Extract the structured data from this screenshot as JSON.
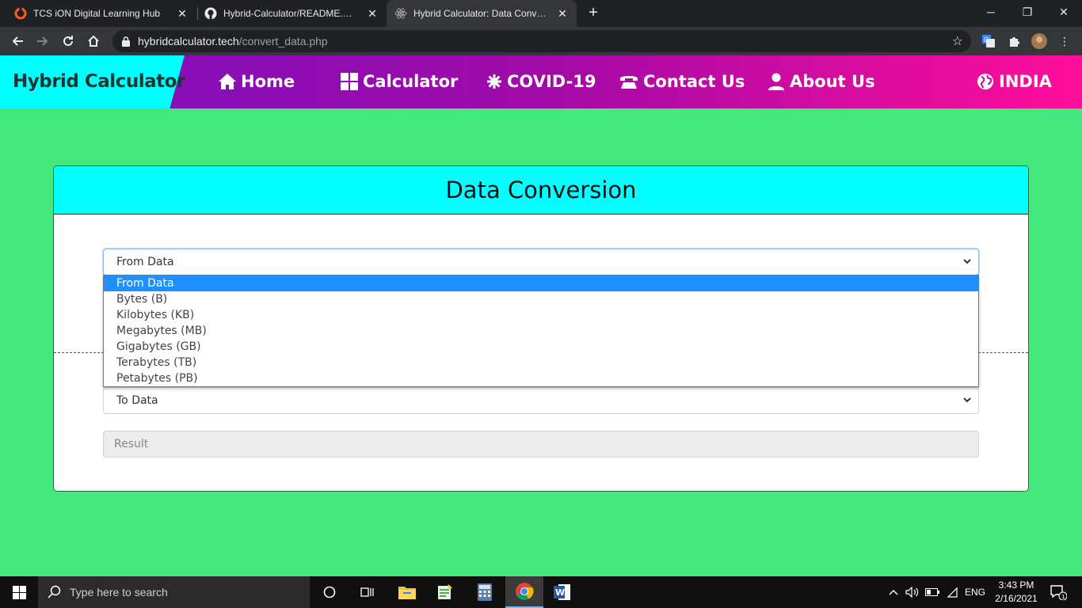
{
  "browser": {
    "tabs": [
      {
        "title": "TCS iON Digital Learning Hub",
        "icon": "tcs-ion-icon"
      },
      {
        "title": "Hybrid-Calculator/README.md at",
        "icon": "github-icon"
      },
      {
        "title": "Hybrid Calculator: Data Conversion",
        "icon": "atom-icon"
      }
    ],
    "url_domain": "hybridcalculator.tech",
    "url_path": "/convert_data.php"
  },
  "site": {
    "brand": "Hybrid Calculator",
    "nav": [
      {
        "label": "Home",
        "icon": "home-icon"
      },
      {
        "label": "Calculator",
        "icon": "grid-icon"
      },
      {
        "label": "COVID-19",
        "icon": "virus-icon"
      },
      {
        "label": "Contact Us",
        "icon": "phone-icon"
      },
      {
        "label": "About Us",
        "icon": "user-icon"
      }
    ],
    "region": {
      "label": "INDIA",
      "icon": "globe-icon"
    }
  },
  "card": {
    "title": "Data Conversion",
    "from_select": {
      "selected": "From Data"
    },
    "to_select": {
      "selected": "To Data"
    },
    "result_placeholder": "Result",
    "options": [
      "From Data",
      "Bytes (B)",
      "Kilobytes (KB)",
      "Megabytes (MB)",
      "Gigabytes (GB)",
      "Terabytes (TB)",
      "Petabytes (PB)"
    ],
    "highlighted_option": "From Data"
  },
  "taskbar": {
    "search_placeholder": "Type here to search",
    "language": "ENG",
    "time": "3:43 PM",
    "date": "2/16/2021",
    "notification_count": "1"
  },
  "colors": {
    "page_bg": "#45e87c",
    "header_cyan": "#00ffff",
    "nav_gradient_start": "#7a0fbf",
    "nav_gradient_end": "#ff0d9a",
    "option_highlight": "#1e90ff"
  }
}
